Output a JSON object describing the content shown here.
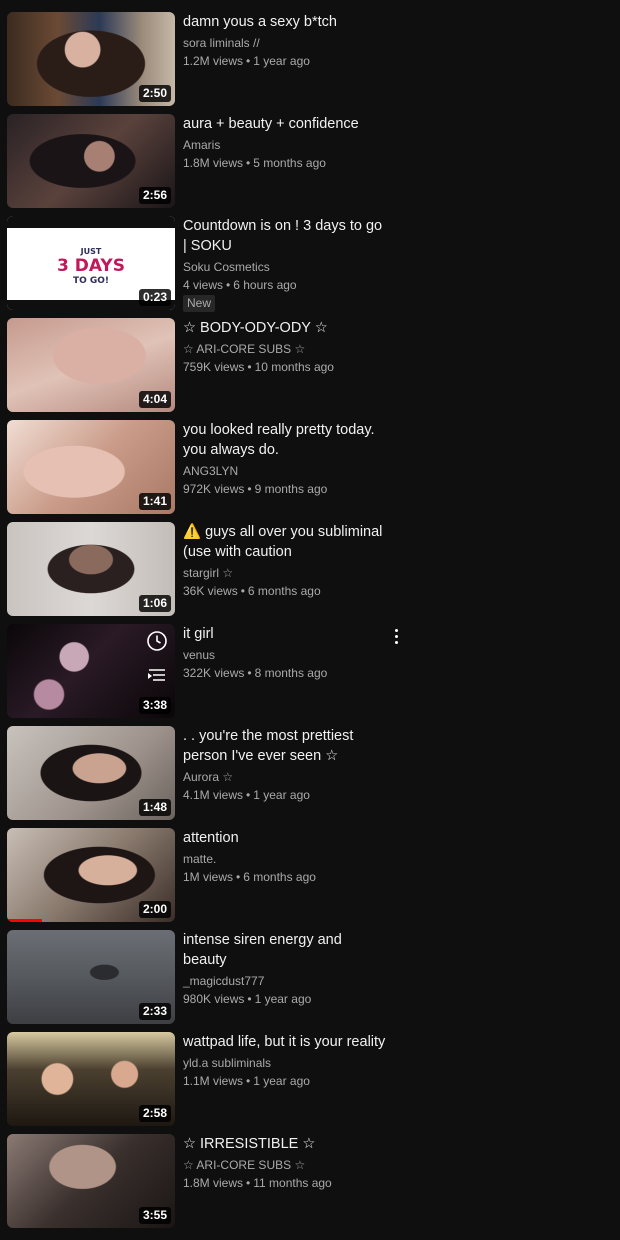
{
  "videos": [
    {
      "title": "damn yous a sexy b*tch",
      "channel": "sora liminals //",
      "views": "1.2M views",
      "age": "1 year ago",
      "duration": "2:50",
      "art": "a1"
    },
    {
      "title": "aura + beauty + confidence",
      "channel": "Amaris",
      "views": "1.8M views",
      "age": "5 months ago",
      "duration": "2:56",
      "art": "a2"
    },
    {
      "title": "Countdown is on ! 3 days to go | SOKU",
      "channel": "Soku Cosmetics",
      "views": "4 views",
      "age": "6 hours ago",
      "duration": "0:23",
      "art": "a3",
      "badge": "New",
      "thumb_text": {
        "line1": "JUST",
        "line2": "3 DAYS",
        "line3": "TO GO!"
      }
    },
    {
      "title": "☆ BODY-ODY-ODY ☆",
      "channel": "☆ ARI-CORE SUBS ☆",
      "views": "759K views",
      "age": "10 months ago",
      "duration": "4:04",
      "art": "a4"
    },
    {
      "title": "you looked really pretty today. you always do.",
      "channel": "ANG3LYN",
      "views": "972K views",
      "age": "9 months ago",
      "duration": "1:41",
      "art": "a5"
    },
    {
      "title": "⚠️ guys all over you subliminal (use with caution",
      "channel": "stargirl ☆",
      "views": "36K views",
      "age": "6 months ago",
      "duration": "1:06",
      "art": "a6"
    },
    {
      "title": "it girl",
      "channel": "venus",
      "views": "322K views",
      "age": "8 months ago",
      "duration": "3:38",
      "art": "a7",
      "hover_icons": [
        "clock-icon",
        "add-to-queue-icon"
      ],
      "menu": true
    },
    {
      "title": ". . you're the most prettiest person I've ever seen ☆",
      "channel": "Aurora ☆",
      "views": "4.1M views",
      "age": "1 year ago",
      "duration": "1:48",
      "art": "a8"
    },
    {
      "title": "attention",
      "channel": "matte.",
      "views": "1M views",
      "age": "6 months ago",
      "duration": "2:00",
      "art": "a9",
      "progress": 0.21
    },
    {
      "title": "intense siren energy and beauty",
      "channel": "_magicdust777",
      "views": "980K views",
      "age": "1 year ago",
      "duration": "2:33",
      "art": "a10"
    },
    {
      "title": "wattpad life, but it is your reality",
      "channel": "yld.a subliminals",
      "views": "1.1M views",
      "age": "1 year ago",
      "duration": "2:58",
      "art": "a11"
    },
    {
      "title": "☆ IRRESISTIBLE ☆",
      "channel": "☆ ARI-CORE SUBS ☆",
      "views": "1.8M views",
      "age": "11 months ago",
      "duration": "3:55",
      "art": "a12"
    }
  ],
  "colors": {
    "background": "#0f0f0f",
    "title": "#f1f1f1",
    "meta": "#aaaaaa",
    "progress": "#ff0000",
    "days_accent": "#c2185b"
  }
}
